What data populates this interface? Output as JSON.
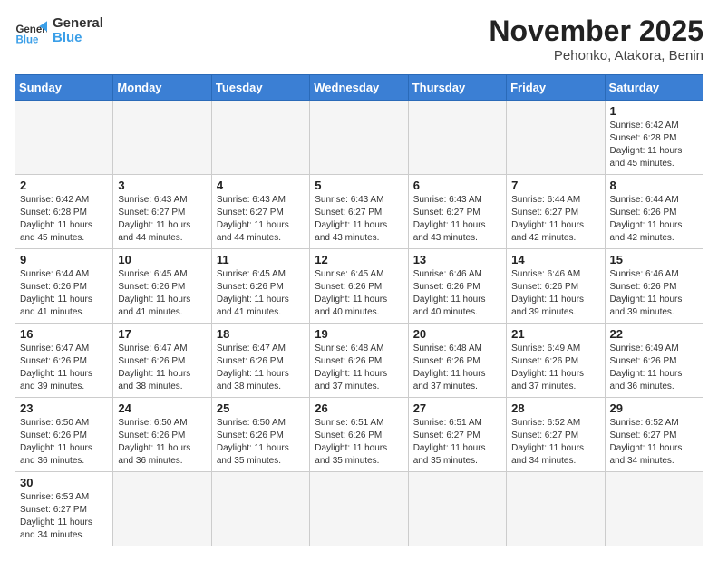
{
  "header": {
    "logo_general": "General",
    "logo_blue": "Blue",
    "month_year": "November 2025",
    "location": "Pehonko, Atakora, Benin"
  },
  "days_of_week": [
    "Sunday",
    "Monday",
    "Tuesday",
    "Wednesday",
    "Thursday",
    "Friday",
    "Saturday"
  ],
  "weeks": [
    [
      {
        "day": "",
        "text": ""
      },
      {
        "day": "",
        "text": ""
      },
      {
        "day": "",
        "text": ""
      },
      {
        "day": "",
        "text": ""
      },
      {
        "day": "",
        "text": ""
      },
      {
        "day": "",
        "text": ""
      },
      {
        "day": "1",
        "text": "Sunrise: 6:42 AM\nSunset: 6:28 PM\nDaylight: 11 hours\nand 45 minutes."
      }
    ],
    [
      {
        "day": "2",
        "text": "Sunrise: 6:42 AM\nSunset: 6:28 PM\nDaylight: 11 hours\nand 45 minutes."
      },
      {
        "day": "3",
        "text": "Sunrise: 6:43 AM\nSunset: 6:27 PM\nDaylight: 11 hours\nand 44 minutes."
      },
      {
        "day": "4",
        "text": "Sunrise: 6:43 AM\nSunset: 6:27 PM\nDaylight: 11 hours\nand 44 minutes."
      },
      {
        "day": "5",
        "text": "Sunrise: 6:43 AM\nSunset: 6:27 PM\nDaylight: 11 hours\nand 43 minutes."
      },
      {
        "day": "6",
        "text": "Sunrise: 6:43 AM\nSunset: 6:27 PM\nDaylight: 11 hours\nand 43 minutes."
      },
      {
        "day": "7",
        "text": "Sunrise: 6:44 AM\nSunset: 6:27 PM\nDaylight: 11 hours\nand 42 minutes."
      },
      {
        "day": "8",
        "text": "Sunrise: 6:44 AM\nSunset: 6:26 PM\nDaylight: 11 hours\nand 42 minutes."
      }
    ],
    [
      {
        "day": "9",
        "text": "Sunrise: 6:44 AM\nSunset: 6:26 PM\nDaylight: 11 hours\nand 41 minutes."
      },
      {
        "day": "10",
        "text": "Sunrise: 6:45 AM\nSunset: 6:26 PM\nDaylight: 11 hours\nand 41 minutes."
      },
      {
        "day": "11",
        "text": "Sunrise: 6:45 AM\nSunset: 6:26 PM\nDaylight: 11 hours\nand 41 minutes."
      },
      {
        "day": "12",
        "text": "Sunrise: 6:45 AM\nSunset: 6:26 PM\nDaylight: 11 hours\nand 40 minutes."
      },
      {
        "day": "13",
        "text": "Sunrise: 6:46 AM\nSunset: 6:26 PM\nDaylight: 11 hours\nand 40 minutes."
      },
      {
        "day": "14",
        "text": "Sunrise: 6:46 AM\nSunset: 6:26 PM\nDaylight: 11 hours\nand 39 minutes."
      },
      {
        "day": "15",
        "text": "Sunrise: 6:46 AM\nSunset: 6:26 PM\nDaylight: 11 hours\nand 39 minutes."
      }
    ],
    [
      {
        "day": "16",
        "text": "Sunrise: 6:47 AM\nSunset: 6:26 PM\nDaylight: 11 hours\nand 39 minutes."
      },
      {
        "day": "17",
        "text": "Sunrise: 6:47 AM\nSunset: 6:26 PM\nDaylight: 11 hours\nand 38 minutes."
      },
      {
        "day": "18",
        "text": "Sunrise: 6:47 AM\nSunset: 6:26 PM\nDaylight: 11 hours\nand 38 minutes."
      },
      {
        "day": "19",
        "text": "Sunrise: 6:48 AM\nSunset: 6:26 PM\nDaylight: 11 hours\nand 37 minutes."
      },
      {
        "day": "20",
        "text": "Sunrise: 6:48 AM\nSunset: 6:26 PM\nDaylight: 11 hours\nand 37 minutes."
      },
      {
        "day": "21",
        "text": "Sunrise: 6:49 AM\nSunset: 6:26 PM\nDaylight: 11 hours\nand 37 minutes."
      },
      {
        "day": "22",
        "text": "Sunrise: 6:49 AM\nSunset: 6:26 PM\nDaylight: 11 hours\nand 36 minutes."
      }
    ],
    [
      {
        "day": "23",
        "text": "Sunrise: 6:50 AM\nSunset: 6:26 PM\nDaylight: 11 hours\nand 36 minutes."
      },
      {
        "day": "24",
        "text": "Sunrise: 6:50 AM\nSunset: 6:26 PM\nDaylight: 11 hours\nand 36 minutes."
      },
      {
        "day": "25",
        "text": "Sunrise: 6:50 AM\nSunset: 6:26 PM\nDaylight: 11 hours\nand 35 minutes."
      },
      {
        "day": "26",
        "text": "Sunrise: 6:51 AM\nSunset: 6:26 PM\nDaylight: 11 hours\nand 35 minutes."
      },
      {
        "day": "27",
        "text": "Sunrise: 6:51 AM\nSunset: 6:27 PM\nDaylight: 11 hours\nand 35 minutes."
      },
      {
        "day": "28",
        "text": "Sunrise: 6:52 AM\nSunset: 6:27 PM\nDaylight: 11 hours\nand 34 minutes."
      },
      {
        "day": "29",
        "text": "Sunrise: 6:52 AM\nSunset: 6:27 PM\nDaylight: 11 hours\nand 34 minutes."
      }
    ],
    [
      {
        "day": "30",
        "text": "Sunrise: 6:53 AM\nSunset: 6:27 PM\nDaylight: 11 hours\nand 34 minutes."
      },
      {
        "day": "",
        "text": ""
      },
      {
        "day": "",
        "text": ""
      },
      {
        "day": "",
        "text": ""
      },
      {
        "day": "",
        "text": ""
      },
      {
        "day": "",
        "text": ""
      },
      {
        "day": "",
        "text": ""
      }
    ]
  ]
}
